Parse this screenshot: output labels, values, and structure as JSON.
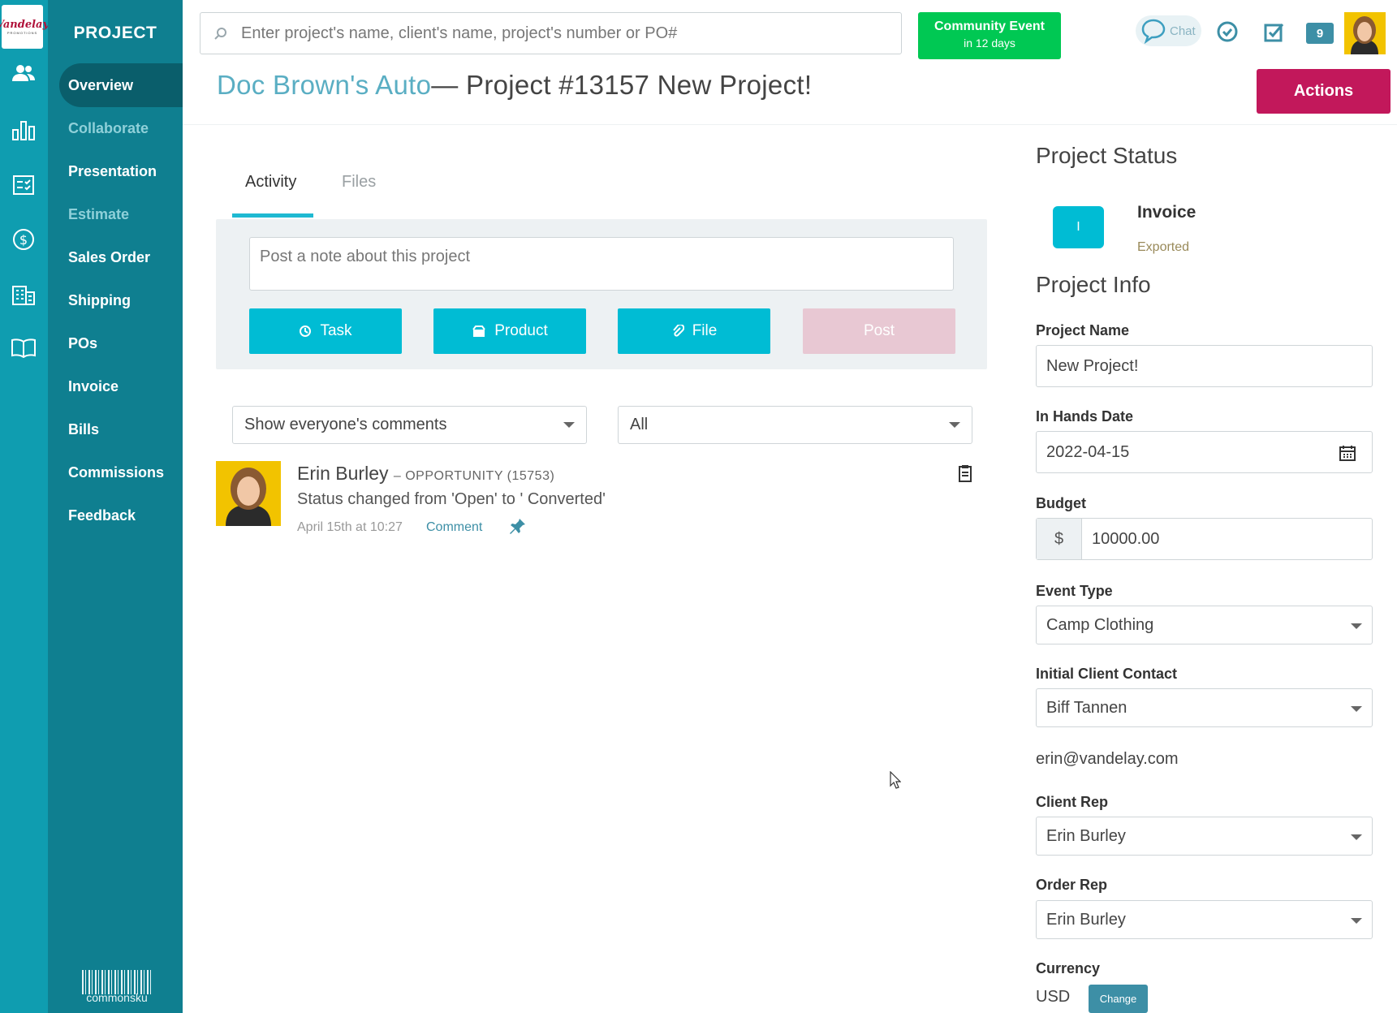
{
  "logo": {
    "text": "Vandelay",
    "sub": "PROMOTIONS"
  },
  "rail_icons": [
    "people-icon",
    "bar-chart-icon",
    "checklist-icon",
    "dollar-icon",
    "building-icon",
    "book-icon"
  ],
  "nav": {
    "title": "PROJECT",
    "items": [
      {
        "label": "Overview",
        "state": "active"
      },
      {
        "label": "Collaborate",
        "state": "muted"
      },
      {
        "label": "Presentation",
        "state": "normal"
      },
      {
        "label": "Estimate",
        "state": "muted"
      },
      {
        "label": "Sales Order",
        "state": "normal"
      },
      {
        "label": "Shipping",
        "state": "normal"
      },
      {
        "label": "POs",
        "state": "normal"
      },
      {
        "label": "Invoice",
        "state": "normal"
      },
      {
        "label": "Bills",
        "state": "normal"
      },
      {
        "label": "Commissions",
        "state": "normal"
      },
      {
        "label": "Feedback",
        "state": "normal"
      }
    ],
    "brand": "commonsku"
  },
  "topbar": {
    "search_placeholder": "Enter project's name, client's name, project's number or PO#",
    "community_title": "Community Event",
    "community_sub": "in 12 days",
    "chat_label": "Chat",
    "notification_count": "9"
  },
  "header": {
    "client": "Doc Brown's Auto",
    "project": "— Project #13157 New Project!",
    "actions_label": "Actions"
  },
  "tabs": {
    "activity": "Activity",
    "files": "Files"
  },
  "note": {
    "placeholder": "Post a note about this project",
    "task": "Task",
    "product": "Product",
    "file": "File",
    "post": "Post"
  },
  "filters": {
    "comments": "Show everyone's comments",
    "type": "All"
  },
  "feed": {
    "author": "Erin Burley",
    "context": "– OPPORTUNITY (15753)",
    "text": "Status changed from 'Open' to ' Converted'",
    "time": "April 15th at 10:27",
    "comment": "Comment"
  },
  "status": {
    "heading": "Project Status",
    "badge": "I",
    "title": "Invoice",
    "sub": "Exported"
  },
  "info": {
    "heading": "Project Info",
    "name_label": "Project Name",
    "name_value": "New Project!",
    "date_label": "In Hands Date",
    "date_value": "2022-04-15",
    "budget_label": "Budget",
    "budget_prefix": "$",
    "budget_value": "10000.00",
    "event_label": "Event Type",
    "event_value": "Camp Clothing",
    "contact_label": "Initial Client Contact",
    "contact_value": "Biff Tannen",
    "contact_email": "erin@vandelay.com",
    "client_rep_label": "Client Rep",
    "client_rep_value": "Erin Burley",
    "order_rep_label": "Order Rep",
    "order_rep_value": "Erin Burley",
    "currency_label": "Currency",
    "currency_value": "USD",
    "change_label": "Change"
  },
  "colors": {
    "rail": "#0f9db0",
    "nav": "#0f7f90",
    "accent": "#00bcd4",
    "actions": "#c2185b",
    "community": "#00c853"
  }
}
